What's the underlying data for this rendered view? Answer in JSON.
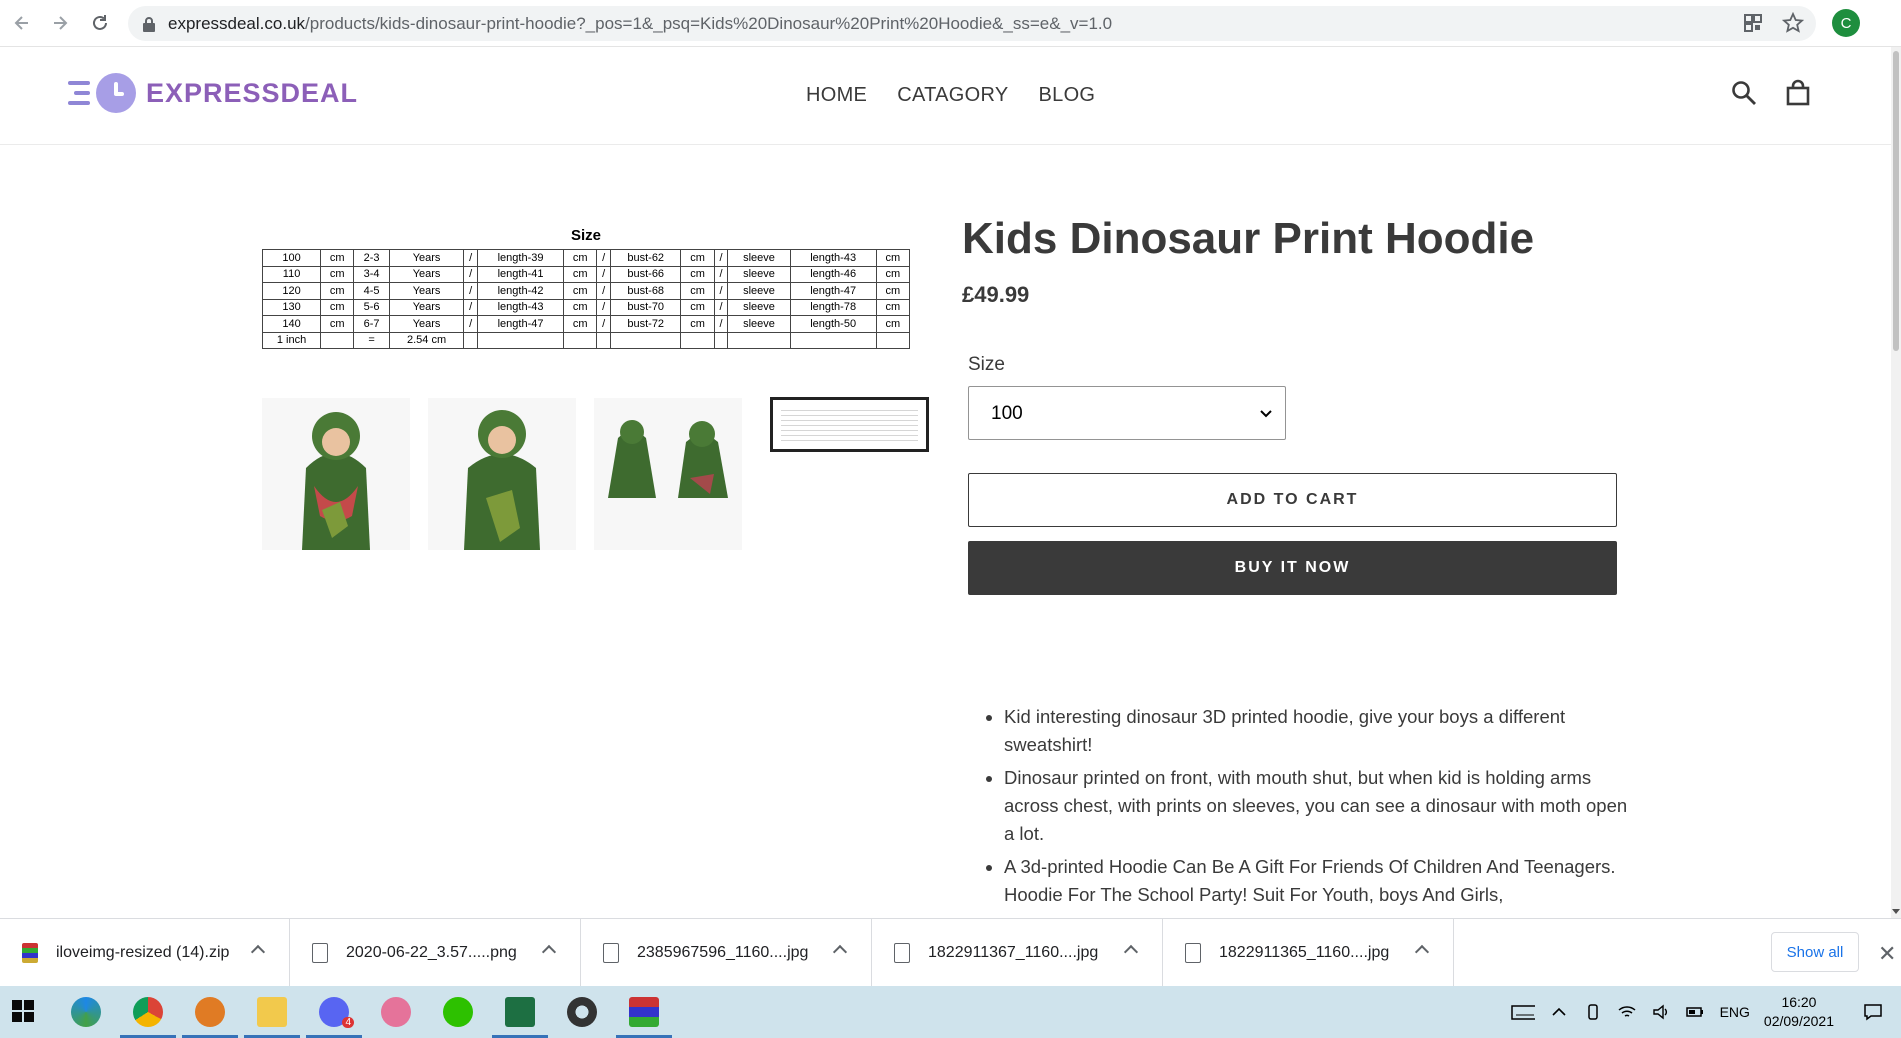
{
  "browser": {
    "url_host": "expressdeal.co.uk",
    "url_path": "/products/kids-dinosaur-print-hoodie?_pos=1&_psq=Kids%20Dinosaur%20Print%20Hoodie&_ss=e&_v=1.0",
    "profile_initial": "C"
  },
  "header": {
    "logo_text": "EXPRESSDEAL",
    "nav": [
      "HOME",
      "CATAGORY",
      "BLOG"
    ]
  },
  "size_chart": {
    "title": "Size",
    "rows": [
      [
        "100",
        "cm",
        "2-3",
        "Years",
        "/",
        "length-39",
        "cm",
        "/",
        "bust-62",
        "cm",
        "/",
        "sleeve",
        "length-43",
        "cm"
      ],
      [
        "110",
        "cm",
        "3-4",
        "Years",
        "/",
        "length-41",
        "cm",
        "/",
        "bust-66",
        "cm",
        "/",
        "sleeve",
        "length-46",
        "cm"
      ],
      [
        "120",
        "cm",
        "4-5",
        "Years",
        "/",
        "length-42",
        "cm",
        "/",
        "bust-68",
        "cm",
        "/",
        "sleeve",
        "length-47",
        "cm"
      ],
      [
        "130",
        "cm",
        "5-6",
        "Years",
        "/",
        "length-43",
        "cm",
        "/",
        "bust-70",
        "cm",
        "/",
        "sleeve",
        "length-78",
        "cm"
      ],
      [
        "140",
        "cm",
        "6-7",
        "Years",
        "/",
        "length-47",
        "cm",
        "/",
        "bust-72",
        "cm",
        "/",
        "sleeve",
        "length-50",
        "cm"
      ],
      [
        "1 inch",
        "",
        "=",
        "2.54 cm",
        "",
        "",
        "",
        "",
        "",
        "",
        "",
        "",
        "",
        ""
      ]
    ]
  },
  "product": {
    "title": "Kids Dinosaur Print Hoodie",
    "price": "£49.99",
    "size_label": "Size",
    "size_value": "100",
    "add_to_cart": "ADD TO CART",
    "buy_now": "BUY IT NOW",
    "description": [
      "Kid interesting dinosaur 3D printed hoodie, give your boys a different sweatshirt!",
      "Dinosaur printed on front, with mouth shut, but when kid is holding arms across chest, with prints on sleeves, you can see a dinosaur with moth open a lot.",
      "A 3d-printed Hoodie Can Be A Gift For Friends Of Children And Teenagers. Hoodie For The School Party! Suit For Youth, boys And Girls,"
    ]
  },
  "downloads": {
    "items": [
      "iloveimg-resized (14).zip",
      "2020-06-22_3.57.....png",
      "2385967596_1160....jpg",
      "1822911367_1160....jpg",
      "1822911365_1160....jpg"
    ],
    "show_all": "Show all"
  },
  "taskbar": {
    "lang": "ENG",
    "time": "16:20",
    "date": "02/09/2021",
    "discord_badge": "4"
  },
  "colors": {
    "brand_purple": "#8c5fb8",
    "logo_lilac": "#a79ee6",
    "dark_button": "#3a3a3a",
    "hoodie_green": "#3e6b2f"
  }
}
